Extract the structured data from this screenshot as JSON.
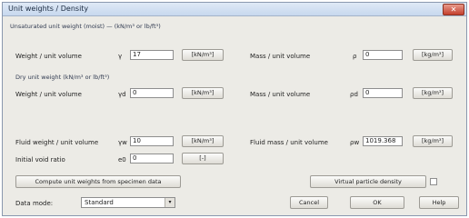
{
  "window": {
    "title": "Unit weights / Density",
    "close_glyph": "✕"
  },
  "hints": {
    "top": "Unsaturated unit weight (moist) — (kN/m³ or lb/ft³)",
    "mid": "Dry unit weight (kN/m³ or lb/ft³)"
  },
  "rows": {
    "weight_unit_volume": {
      "label": "Weight / unit volume",
      "symbol": "γ",
      "value": "17",
      "units_btn": "[kN/m³]",
      "right_label": "Mass / unit volume",
      "right_symbol": "ρ",
      "right_value": "0",
      "right_btn": "[kg/m³]"
    },
    "dry_weight": {
      "label": "Weight / unit volume",
      "symbol": "γd",
      "value": "0",
      "units_btn": "[kN/m³]",
      "right_label": "Mass / unit volume",
      "right_symbol": "ρd",
      "right_value": "0",
      "right_btn": "[kg/m³]"
    },
    "fluid_weight": {
      "label": "Fluid weight / unit volume",
      "symbol": "γw",
      "value": "10",
      "units_btn": "[kN/m³]",
      "right_label": "Fluid mass / unit volume",
      "right_symbol": "ρw",
      "right_value": "1019.368",
      "right_btn": "[kg/m³]"
    },
    "initial_void": {
      "label": "Initial void ratio",
      "symbol": "e0",
      "value": "0",
      "btn": "[-]"
    }
  },
  "buttons": {
    "compute": "Compute unit weights from specimen data",
    "virtual_density": "Virtual particle density",
    "cancel": "Cancel",
    "ok": "OK",
    "help": "Help"
  },
  "data_mode": {
    "label": "Data mode:",
    "value": "Standard",
    "arrow": "▾"
  }
}
